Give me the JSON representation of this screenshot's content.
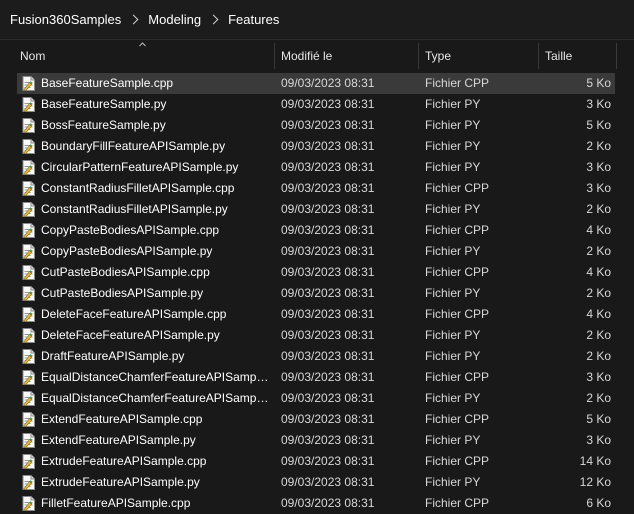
{
  "breadcrumb": {
    "items": [
      "Fusion360Samples",
      "Modeling",
      "Features"
    ]
  },
  "columns": {
    "name": "Nom",
    "modified": "Modifié le",
    "type": "Type",
    "size": "Taille"
  },
  "colors": {
    "background": "#191919",
    "selected_row": "#3a3a3a",
    "text": "#ffffff",
    "secondary_text": "#d8d8d8"
  },
  "files": [
    {
      "name": "BaseFeatureSample.cpp",
      "date": "09/03/2023 08:31",
      "type": "Fichier CPP",
      "size": "5 Ko",
      "selected": true
    },
    {
      "name": "BaseFeatureSample.py",
      "date": "09/03/2023 08:31",
      "type": "Fichier PY",
      "size": "3 Ko"
    },
    {
      "name": "BossFeatureSample.py",
      "date": "09/03/2023 08:31",
      "type": "Fichier PY",
      "size": "5 Ko"
    },
    {
      "name": "BoundaryFillFeatureAPISample.py",
      "date": "09/03/2023 08:31",
      "type": "Fichier PY",
      "size": "2 Ko"
    },
    {
      "name": "CircularPatternFeatureAPISample.py",
      "date": "09/03/2023 08:31",
      "type": "Fichier PY",
      "size": "3 Ko"
    },
    {
      "name": "ConstantRadiusFilletAPISample.cpp",
      "date": "09/03/2023 08:31",
      "type": "Fichier CPP",
      "size": "3 Ko"
    },
    {
      "name": "ConstantRadiusFilletAPISample.py",
      "date": "09/03/2023 08:31",
      "type": "Fichier PY",
      "size": "2 Ko"
    },
    {
      "name": "CopyPasteBodiesAPISample.cpp",
      "date": "09/03/2023 08:31",
      "type": "Fichier CPP",
      "size": "4 Ko"
    },
    {
      "name": "CopyPasteBodiesAPISample.py",
      "date": "09/03/2023 08:31",
      "type": "Fichier PY",
      "size": "2 Ko"
    },
    {
      "name": "CutPasteBodiesAPISample.cpp",
      "date": "09/03/2023 08:31",
      "type": "Fichier CPP",
      "size": "4 Ko"
    },
    {
      "name": "CutPasteBodiesAPISample.py",
      "date": "09/03/2023 08:31",
      "type": "Fichier PY",
      "size": "2 Ko"
    },
    {
      "name": "DeleteFaceFeatureAPISample.cpp",
      "date": "09/03/2023 08:31",
      "type": "Fichier CPP",
      "size": "4 Ko"
    },
    {
      "name": "DeleteFaceFeatureAPISample.py",
      "date": "09/03/2023 08:31",
      "type": "Fichier PY",
      "size": "2 Ko"
    },
    {
      "name": "DraftFeatureAPISample.py",
      "date": "09/03/2023 08:31",
      "type": "Fichier PY",
      "size": "2 Ko"
    },
    {
      "name": "EqualDistanceChamferFeatureAPISample...",
      "date": "09/03/2023 08:31",
      "type": "Fichier CPP",
      "size": "3 Ko"
    },
    {
      "name": "EqualDistanceChamferFeatureAPISample...",
      "date": "09/03/2023 08:31",
      "type": "Fichier PY",
      "size": "2 Ko"
    },
    {
      "name": "ExtendFeatureAPISample.cpp",
      "date": "09/03/2023 08:31",
      "type": "Fichier CPP",
      "size": "5 Ko"
    },
    {
      "name": "ExtendFeatureAPISample.py",
      "date": "09/03/2023 08:31",
      "type": "Fichier PY",
      "size": "3 Ko"
    },
    {
      "name": "ExtrudeFeatureAPISample.cpp",
      "date": "09/03/2023 08:31",
      "type": "Fichier CPP",
      "size": "14 Ko"
    },
    {
      "name": "ExtrudeFeatureAPISample.py",
      "date": "09/03/2023 08:31",
      "type": "Fichier PY",
      "size": "12 Ko"
    },
    {
      "name": "FilletFeatureAPISample.cpp",
      "date": "09/03/2023 08:31",
      "type": "Fichier CPP",
      "size": "6 Ko"
    }
  ]
}
